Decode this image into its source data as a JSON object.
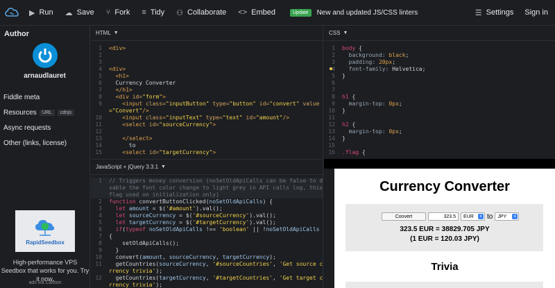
{
  "toolbar": {
    "run": "Run",
    "save": "Save",
    "fork": "Fork",
    "tidy": "Tidy",
    "collaborate": "Collaborate",
    "embed": "Embed",
    "update_badge": "Update",
    "update_text": "New and updated JS/CSS linters",
    "settings": "Settings",
    "sign_in": "Sign in"
  },
  "sidebar": {
    "author_title": "Author",
    "author_name": "arnaudlauret",
    "fiddle_meta": "Fiddle meta",
    "resources": "Resources",
    "resource_tags": [
      "URL",
      "cdnjs"
    ],
    "async": "Async requests",
    "other": "Other (links, license)",
    "ad_name": "RapidSeedbox",
    "ad_text": "High-performance VPS Seedbox that works for you. Try it now.",
    "ad_via": "ads via Carbon"
  },
  "panels": {
    "html_label": "HTML",
    "css_label": "CSS",
    "js_label": "JavaScript + jQuery 3.3.1"
  },
  "result": {
    "title": "Currency Converter",
    "convert_button": "Convert",
    "amount_value": "323.5",
    "source_currency": "EUR",
    "to_label": "to",
    "target_currency": "JPY",
    "result_line1": "323.5 EUR = 38829.705 JPY",
    "result_line2": "(1 EUR = 120.03 JPY)",
    "trivia_title": "Trivia"
  },
  "colors": {
    "accent_green": "#39a450",
    "avatar_blue": "#0a8fd8",
    "background": "#1c1e22"
  }
}
